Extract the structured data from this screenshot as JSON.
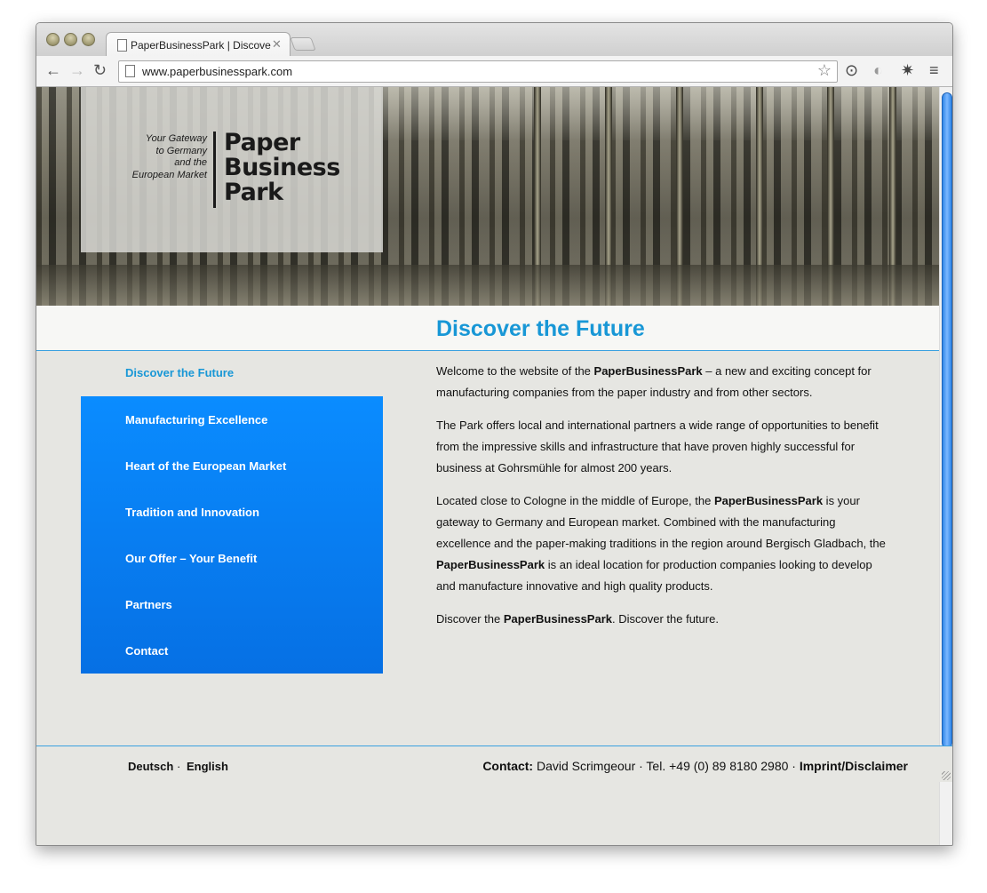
{
  "browser": {
    "tab_title": "PaperBusinessPark | Discover the Future",
    "url": "www.paperbusinesspark.com"
  },
  "hero": {
    "tagline": [
      "Your Gateway",
      "to Germany",
      "and the",
      "European Market"
    ],
    "logo": [
      "Paper",
      "Business",
      "Park"
    ]
  },
  "page_title": "Discover the Future",
  "nav": {
    "active": "Discover the Future",
    "items": [
      "Manufacturing Excellence",
      "Heart of the European Market",
      "Tradition and Innovation",
      "Our Offer – Your Benefit",
      "Partners",
      "Contact"
    ]
  },
  "content": {
    "p1_a": "Welcome to the website of the ",
    "p1_b": "PaperBusinessPark",
    "p1_c": " – a new and exciting concept for manufacturing companies from the paper industry and from other sectors.",
    "p2": "The Park offers local and international partners a wide range of opportunities to benefit from the impressive skills and infrastructure that have proven highly successful for business at Gohrsmühle for almost 200 years.",
    "p3_a": "Located close to Cologne in the middle of Europe, the ",
    "p3_b": "PaperBusinessPark",
    "p3_c": " is your gateway to Germany and European market. Combined with the manufacturing excellence and the paper-making traditions in the region around Bergisch Gladbach, the ",
    "p3_d": "PaperBusinessPark",
    "p3_e": " is an ideal location for production companies looking to develop and manufacture innovative and high quality products.",
    "p4_a": "Discover the ",
    "p4_b": "PaperBusinessPark",
    "p4_c": ". Discover the future."
  },
  "footer": {
    "lang_de": "Deutsch",
    "lang_sep": "·",
    "lang_en": "English",
    "contact_label": "Contact:",
    "contact_text": " David Scrimgeour · Tel. +49 (0) 89 8180 2980 · ",
    "imprint": "Imprint/Disclaimer"
  },
  "colors": {
    "accent": "#1897d6",
    "nav_blue": "#0a8cff",
    "background": "#e6e6e2"
  }
}
